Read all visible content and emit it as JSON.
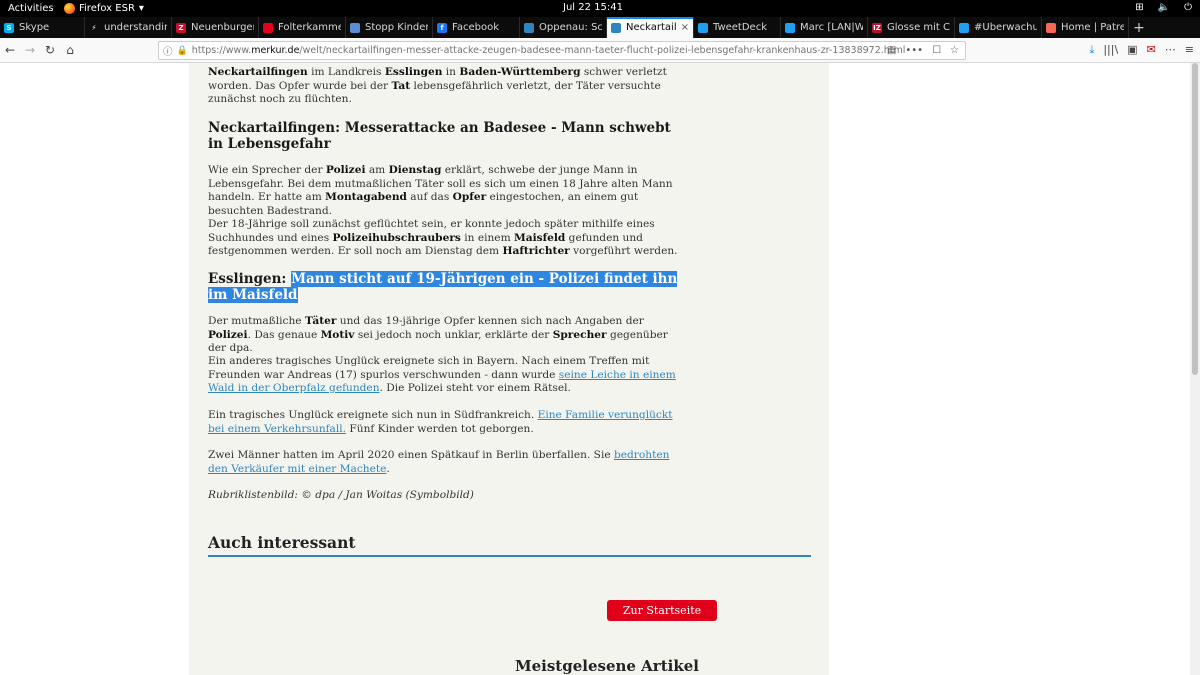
{
  "topbar": {
    "activities": "Activities",
    "app_name": "Firefox ESR",
    "app_caret": "▾",
    "clock": "Jul 22  15:41",
    "tray": [
      "⊞",
      "🔈",
      "⏻"
    ]
  },
  "tabs": [
    {
      "title": "Skype",
      "fav_color": "#00aff0",
      "fav_glyph": "S"
    },
    {
      "title": "understanding",
      "fav_color": "#0c0c0d",
      "fav_glyph": "⚡"
    },
    {
      "title": "Neuenburgers",
      "fav_color": "#c8102e",
      "fav_glyph": "Z"
    },
    {
      "title": "Folterkammer",
      "fav_color": "#e2001a",
      "fav_glyph": ""
    },
    {
      "title": "Stopp Kinderp",
      "fav_color": "#5a8dd6",
      "fav_glyph": ""
    },
    {
      "title": "Facebook",
      "fav_color": "#1877f2",
      "fav_glyph": "f"
    },
    {
      "title": "Oppenau: Sch",
      "fav_color": "#2e86c1",
      "fav_glyph": ""
    },
    {
      "title": "Neckartailf",
      "fav_color": "#2e86c1",
      "fav_glyph": "",
      "active": true,
      "close": "×"
    },
    {
      "title": "TweetDeck",
      "fav_color": "#1da1f2",
      "fav_glyph": ""
    },
    {
      "title": "Marc [LAN|W",
      "fav_color": "#1da1f2",
      "fav_glyph": ""
    },
    {
      "title": "Glosse mit CIA",
      "fav_color": "#b3142a",
      "fav_glyph": "IZ"
    },
    {
      "title": "#Überwachun",
      "fav_color": "#1da1f2",
      "fav_glyph": ""
    },
    {
      "title": "Home | Patreo",
      "fav_color": "#f96854",
      "fav_glyph": ""
    }
  ],
  "newtab": "+",
  "nav": {
    "back": "←",
    "forward": "→",
    "reload": "↻",
    "home": "⌂",
    "url_prefix": "https://www.",
    "url_domain": "merkur.de",
    "url_rest": "/welt/neckartailfingen-messer-attacke-zeugen-badesee-mann-taeter-flucht-polizei-lebensgefahr-krankenhaus-zr-13838972.html",
    "url_icons": [
      "▤",
      "•••",
      "☐",
      "☆"
    ],
    "right_icons": [
      "⤓",
      "|||\\",
      "▣",
      "✉",
      "⋯",
      "≡"
    ]
  },
  "article": {
    "p_intro": {
      "t1": "Neckartailfingen",
      "t2": " im Landkreis ",
      "t3": "Esslingen",
      "t4": " in ",
      "t5": "Baden-Württemberg",
      "t6": " schwer verletzt worden. Das Opfer wurde bei der ",
      "t7": "Tat",
      "t8": " lebensgefährlich verletzt, der Täter versuchte zunächst noch zu flüchten."
    },
    "h_neckar": "Neckartailfingen: Messerattacke an Badesee - Mann schwebt in Lebensgefahr",
    "p1": {
      "t1": "Wie ein Sprecher der ",
      "t2": "Polizei",
      "t3": " am ",
      "t4": "Dienstag",
      "t5": " erklärt, schwebe der junge Mann in Lebensgefahr. Bei dem mutmaßlichen Täter soll es sich um einen 18 Jahre alten Mann handeln. Er hatte am ",
      "t6": "Montagabend",
      "t7": " auf das ",
      "t8": "Opfer",
      "t9": " eingestochen, an einem gut besuchten Badestrand."
    },
    "p2": {
      "t1": "Der 18-Jährige soll zunächst geflüchtet sein, er konnte jedoch später mithilfe eines Suchhundes und eines ",
      "t2": "Polizeihubschraubers",
      "t3": " in einem ",
      "t4": "Maisfeld",
      "t5": " gefunden und festgenommen werden. Er soll noch am Dienstag dem ",
      "t6": "Haftrichter",
      "t7": " vorgeführt werden."
    },
    "h_ess_a": "Esslingen: ",
    "h_ess_b": "Mann sticht auf 19-Jährigen ein - Polizei findet ihn im Maisfeld",
    "p3": {
      "t1": "Der mutmaßliche ",
      "t2": "Täter",
      "t3": " und das 19-jährige Opfer kennen sich nach Angaben der ",
      "t4": "Polizei",
      "t5": ". Das genaue ",
      "t6": "Motiv",
      "t7": " sei jedoch noch unklar, erklärte der ",
      "t8": "Sprecher",
      "t9": " gegenüber der dpa."
    },
    "p4": {
      "t1": "Ein anderes tragisches Unglück ereignete sich in Bayern. Nach einem Treffen mit Freunden war Andreas (17) spurlos verschwunden - dann wurde ",
      "link": "seine Leiche in einem Wald in der Oberpfalz gefunden",
      "t2": ". Die Polizei steht vor einem Rätsel."
    },
    "p5": {
      "t1": "Ein tragisches Unglück ereignete sich nun in Südfrankreich. ",
      "link": "Eine Familie verunglückt bei einem Verkehrsunfall.",
      "t2": " Fünf Kinder werden tot geborgen."
    },
    "p6": {
      "t1": "Zwei Männer hatten im April 2020 einen Spätkauf in Berlin überfallen. Sie ",
      "link": "bedrohten den Verkäufer mit einer Machete",
      "t2": "."
    },
    "caption": "Rubriklistenbild:  ©  dpa / Jan Woitas (Symbolbild)",
    "auch": "Auch interessant",
    "start_button": "Zur Startseite",
    "meist": "Meistgelesene Artikel"
  }
}
